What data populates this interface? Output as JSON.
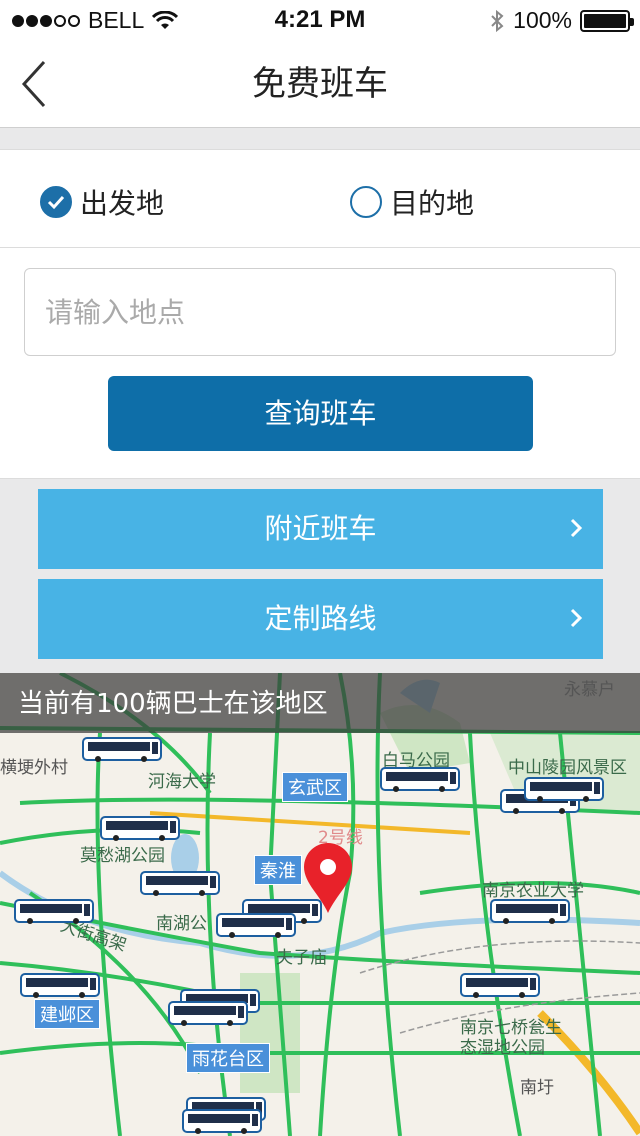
{
  "status": {
    "carrier": "BELL",
    "time": "4:21 PM",
    "battery": "100%"
  },
  "nav": {
    "title": "免费班车",
    "back_icon": "chevron-left-icon"
  },
  "form": {
    "departure_label": "出发地",
    "departure_checked": true,
    "destination_label": "目的地",
    "destination_checked": false,
    "location_placeholder": "请输入地点",
    "location_value": "",
    "query_button": "查询班车"
  },
  "menu": {
    "nearby_label": "附近班车",
    "custom_route_label": "定制路线"
  },
  "map": {
    "banner": "当前有100辆巴士在该地区",
    "labels": {
      "yongmu": "永慕户",
      "hengtang": "横埂外村",
      "hehai": "河海大学",
      "xuanwu": "玄武区",
      "baima": "白马公园",
      "zhongshan": "中山陵园风景区",
      "line2": "2号线",
      "mochou": "莫愁湖公园",
      "qinhuai": "秦淮",
      "njau": "南京农业大学",
      "nanhu": "南湖公",
      "dajie": "大街高架",
      "fuzimiao": "夫子庙",
      "jianye": "建邺区",
      "qiqiao_1": "南京七桥瓮生",
      "qiqiao_2": "态湿地公园",
      "yuhuatai": "雨花台区",
      "nanyu": "南圩"
    },
    "colors": {
      "road_green": "#2fbf5a",
      "road_yellow": "#f3b82a",
      "water": "#a9cfe8",
      "park": "#cfe6c4",
      "pin": "#e8222a"
    },
    "bus_icon": "bus-icon",
    "pin_icon": "location-pin-icon"
  }
}
